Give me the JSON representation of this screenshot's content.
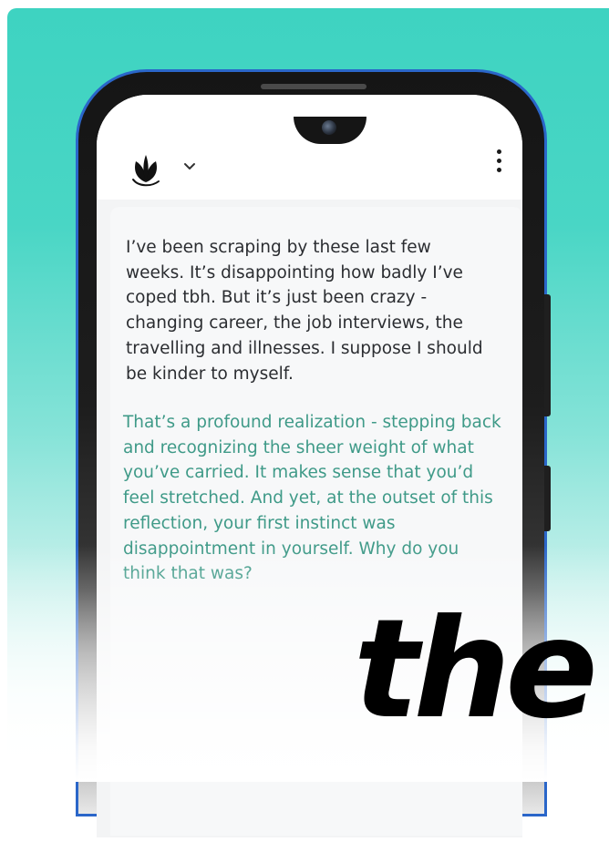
{
  "conversation": {
    "user_message": "I’ve been scraping by these last few weeks. It’s disappointing how badly I’ve coped tbh. But it’s just been crazy - changing career, the job interviews, the travelling and illnesses. I suppose I should be kinder to myself.",
    "ai_message": "That’s a profound realization - stepping back and recognizing the sheer weight of what you’ve carried. It makes sense that you’d feel stretched. And yet, at the outset of this reflection, your first instinct was disappointment in yourself. Why do you think that was?"
  },
  "overlay": {
    "word": "the"
  },
  "header": {
    "logo_icon": "leaf-logo-icon",
    "dropdown_icon": "chevron-down-icon",
    "menu_icon": "kebab-menu-icon"
  },
  "colors": {
    "background_top": "#3ed3c1",
    "ai_text": "#3f9a88",
    "user_text": "#2b2d31",
    "phone_edge": "#2a66c9"
  }
}
